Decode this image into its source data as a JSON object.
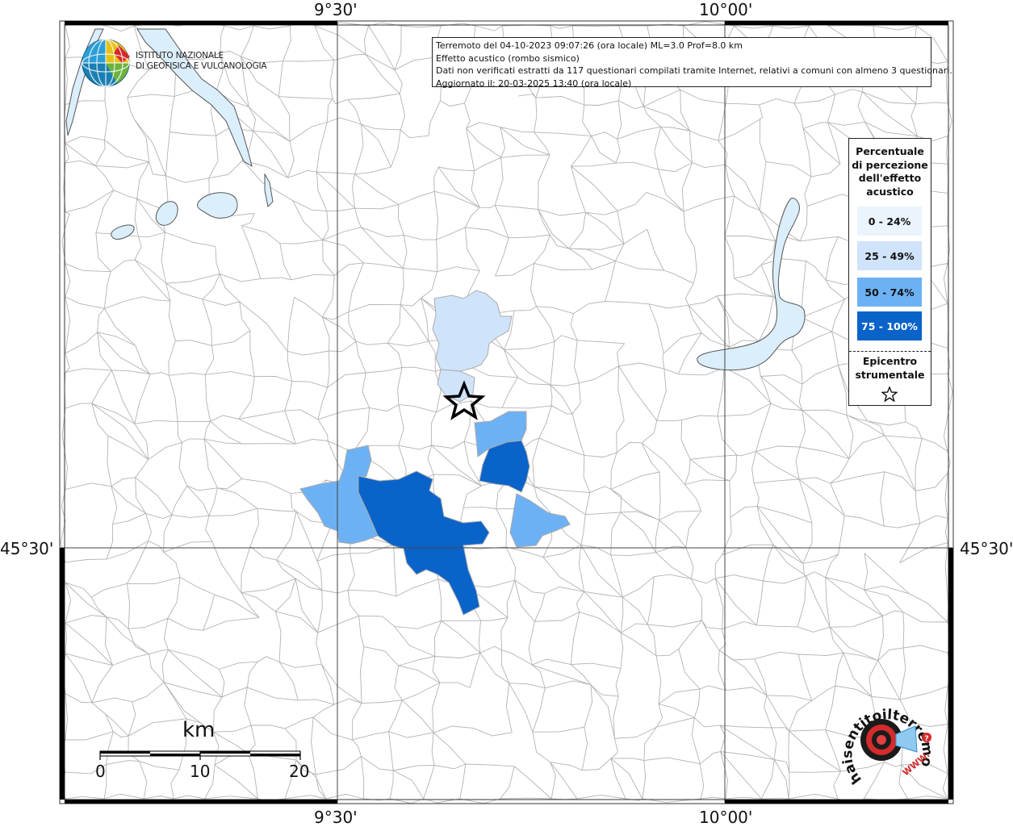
{
  "map": {
    "coordinate_labels": {
      "top_left_lon": "9°30'",
      "top_right_lon": "10°00'",
      "bottom_left_lon": "9°30'",
      "bottom_right_lon": "10°00'",
      "left_lat": "45°30'",
      "right_lat": "45°30'"
    },
    "colors": {
      "water": "#dbeefc",
      "boundary": "#b3b3b3",
      "class_0_24": "#eaf4fd",
      "class_25_49": "#cfe4fa",
      "class_50_74": "#6db1f5",
      "class_75_100": "#0a63c9"
    }
  },
  "info": {
    "line1": "Terremoto del 04-10-2023 09:07:26 (ora locale) ML=3.0 Prof=8.0 km",
    "line2": "Effetto acustico (rombo sismico)",
    "line3": "Dati non verificati estratti da 117 questionari compilati tramite Internet, relativi a comuni con almeno 3 questionari.",
    "line4": "Aggiornato il: 20-03-2025 13:40 (ora locale)"
  },
  "institute": {
    "line1": "ISTITUTO NAZIONALE",
    "line2": "DI GEOFISICA E VULCANOLOGIA"
  },
  "legend": {
    "title_1": "Percentuale",
    "title_2": "di percezione",
    "title_3": "dell'effetto",
    "title_4": "acustico",
    "items": [
      {
        "label": "0 - 24%",
        "color": "#eaf4fd"
      },
      {
        "label": "25 - 49%",
        "color": "#cfe4fa"
      },
      {
        "label": "50 - 74%",
        "color": "#6db1f5"
      },
      {
        "label": "75 - 100%",
        "color": "#0a63c9"
      }
    ],
    "epicenter_1": "Epicentro",
    "epicenter_2": "strumentale",
    "epicenter_icon": "star-icon"
  },
  "scale": {
    "unit": "km",
    "tick_0": "0",
    "tick_10": "10",
    "tick_20": "20"
  },
  "brand": {
    "ring_text": "haisentitoilterremoto.it",
    "url_text": "WWW."
  }
}
